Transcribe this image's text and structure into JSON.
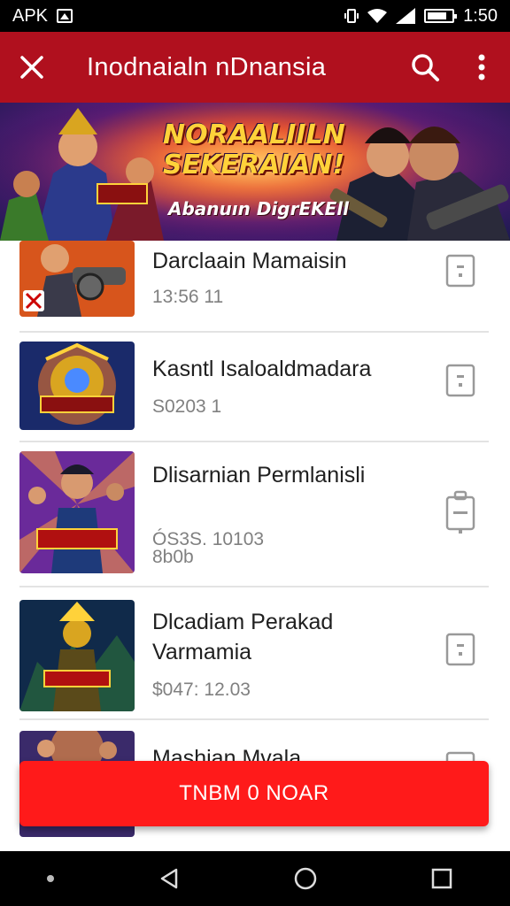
{
  "status_bar": {
    "apk_label": "APK",
    "time": "1:50",
    "icons": [
      "image-icon",
      "vibrate-icon",
      "wifi-icon",
      "signal-icon",
      "battery-icon"
    ]
  },
  "app_bar": {
    "title": "Inodnaialn nDnansia",
    "icons": [
      "close-icon",
      "search-icon",
      "more-vert-icon"
    ],
    "color": "#b0101e"
  },
  "banner": {
    "title": "NORAALIILN SEKERAIAN!",
    "subtitle": "Abanuın DigrEKEll"
  },
  "list": {
    "items": [
      {
        "name": "Darclaain Mamaisin",
        "meta": "13:56 11",
        "icon": "document-icon"
      },
      {
        "name": "Kasntl Isaloaldmadara",
        "meta": "S0203 1",
        "icon": "document-icon"
      },
      {
        "name": "Dlisarnian Permlanisli",
        "meta": "ÓS3S. 10103 8b0b",
        "icon": "clipboard-icon"
      },
      {
        "name": "Dlcadiam Perakad Varmamia",
        "meta": "$047: 12.03",
        "icon": "document-icon"
      },
      {
        "name": "Mashian Mvala",
        "meta": "",
        "icon": "document-icon"
      }
    ]
  },
  "cta": {
    "label": "TNBM 0 NOAR",
    "color": "#ff1a1a"
  },
  "nav_bar": {
    "icons": [
      "back-icon",
      "home-icon",
      "recents-icon"
    ]
  }
}
